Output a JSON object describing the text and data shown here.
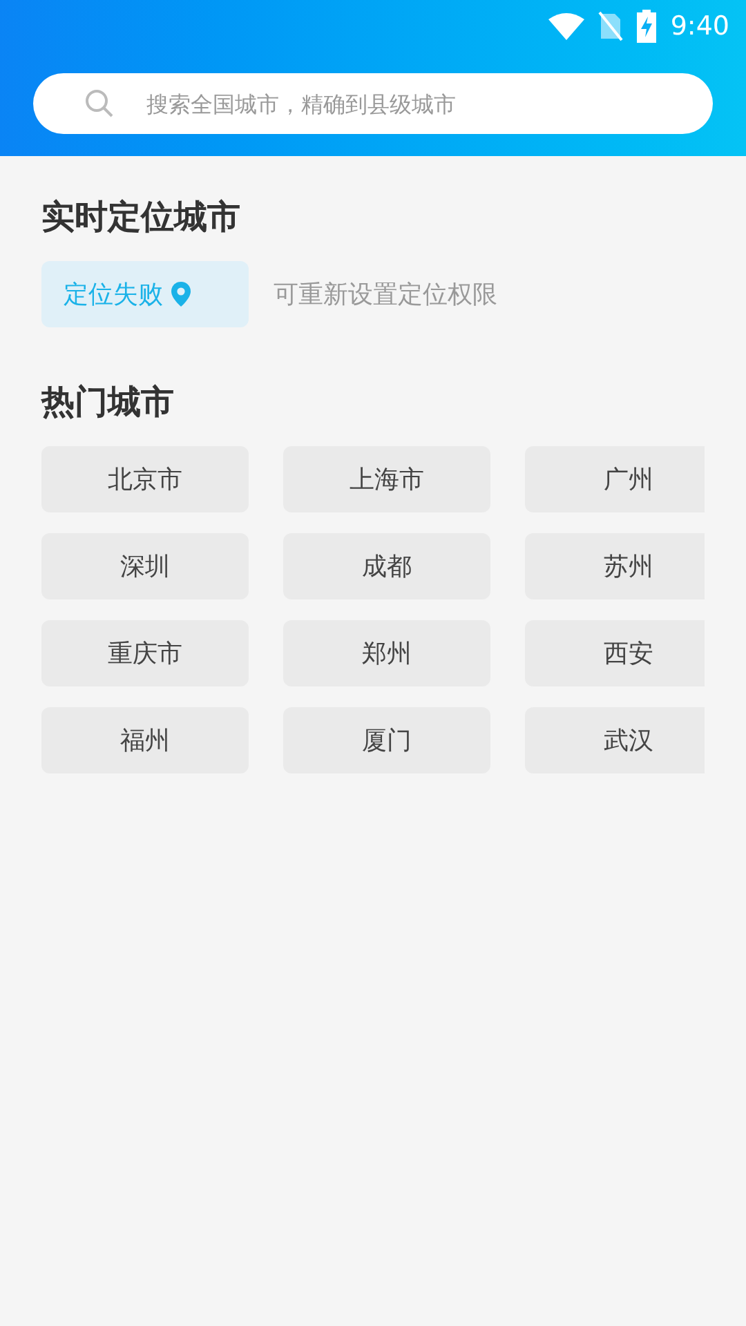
{
  "status_bar": {
    "time": "9:40"
  },
  "search": {
    "placeholder": "搜索全国城市，精确到县级城市"
  },
  "location": {
    "title": "实时定位城市",
    "status": "定位失败",
    "hint": "可重新设置定位权限"
  },
  "hot_cities": {
    "title": "热门城市",
    "items": [
      "北京市",
      "上海市",
      "广州",
      "深圳",
      "成都",
      "苏州",
      "重庆市",
      "郑州",
      "西安",
      "福州",
      "厦门",
      "武汉"
    ]
  }
}
